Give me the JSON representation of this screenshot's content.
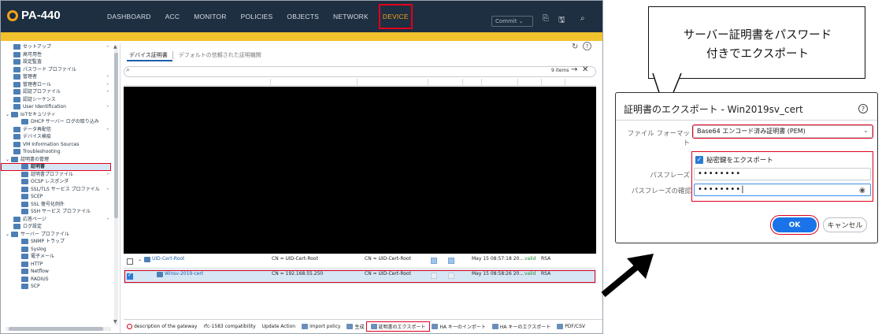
{
  "app": {
    "logo_text": "PA-440",
    "nav": [
      "DASHBOARD",
      "ACC",
      "MONITOR",
      "POLICIES",
      "OBJECTS",
      "NETWORK",
      "DEVICE"
    ],
    "active_nav": "DEVICE",
    "commit_label": "Commit",
    "accent_color": "#f3a21b",
    "highlight_color": "#e0001b"
  },
  "sidebar": {
    "items": [
      {
        "label": "セットアップ",
        "indent": 1,
        "icon": "setup-icon",
        "dot": true
      },
      {
        "label": "高可用性",
        "indent": 1,
        "icon": "ha-icon"
      },
      {
        "label": "設定監査",
        "indent": 1,
        "icon": "audit-icon"
      },
      {
        "label": "パスワード プロファイル",
        "indent": 1,
        "icon": "password-icon"
      },
      {
        "label": "管理者",
        "indent": 1,
        "icon": "admin-icon",
        "dot": true
      },
      {
        "label": "管理者ロール",
        "indent": 1,
        "icon": "role-icon",
        "dot": true
      },
      {
        "label": "認証プロファイル",
        "indent": 1,
        "icon": "auth-profile-icon",
        "dot": true
      },
      {
        "label": "認証シーケンス",
        "indent": 1,
        "icon": "auth-seq-icon"
      },
      {
        "label": "User Identification",
        "indent": 1,
        "icon": "user-id-icon",
        "dot": true
      },
      {
        "label": "IoTセキュリティ",
        "indent": 0,
        "icon": "iot-icon",
        "expander": true
      },
      {
        "label": "DHCP サーバー ログの取り込み",
        "indent": 2,
        "icon": "dhcp-icon"
      },
      {
        "label": "データ再配信",
        "indent": 1,
        "icon": "redistribution-icon",
        "dot": true
      },
      {
        "label": "デバイス検疫",
        "indent": 1,
        "icon": "quarantine-icon"
      },
      {
        "label": "VM Information Sources",
        "indent": 1,
        "icon": "vm-icon"
      },
      {
        "label": "Troubleshooting",
        "indent": 1,
        "icon": "troubleshoot-icon"
      },
      {
        "label": "証明書の管理",
        "indent": 0,
        "icon": "cert-mgmt-icon",
        "expander": true
      },
      {
        "label": "証明書",
        "indent": 2,
        "icon": "cert-icon",
        "active": true
      },
      {
        "label": "証明書プロファイル",
        "indent": 2,
        "icon": "cert-profile-icon",
        "dot": true
      },
      {
        "label": "OCSP レスポンダ",
        "indent": 2,
        "icon": "ocsp-icon"
      },
      {
        "label": "SSL/TLS サービス プロファイル",
        "indent": 2,
        "icon": "ssl-profile-icon",
        "dot": true
      },
      {
        "label": "SCEP",
        "indent": 2,
        "icon": "scep-icon"
      },
      {
        "label": "SSL 復号化例外",
        "indent": 2,
        "icon": "ssl-exclusion-icon"
      },
      {
        "label": "SSH サービス プロファイル",
        "indent": 2,
        "icon": "ssh-profile-icon"
      },
      {
        "label": "応答ページ",
        "indent": 1,
        "icon": "response-page-icon",
        "dot": true
      },
      {
        "label": "ログ設定",
        "indent": 1,
        "icon": "log-settings-icon"
      },
      {
        "label": "サーバー プロファイル",
        "indent": 0,
        "icon": "server-profile-icon",
        "expander": true
      },
      {
        "label": "SNMP トラップ",
        "indent": 2,
        "icon": "snmp-icon"
      },
      {
        "label": "Syslog",
        "indent": 2,
        "icon": "syslog-icon"
      },
      {
        "label": "電子メール",
        "indent": 2,
        "icon": "email-icon"
      },
      {
        "label": "HTTP",
        "indent": 2,
        "icon": "http-icon"
      },
      {
        "label": "Netflow",
        "indent": 2,
        "icon": "netflow-icon"
      },
      {
        "label": "RADIUS",
        "indent": 2,
        "icon": "radius-icon"
      },
      {
        "label": "SCP",
        "indent": 2,
        "icon": "scp-icon"
      }
    ]
  },
  "content": {
    "tabs": [
      {
        "label": "デバイス証明書",
        "active": true
      },
      {
        "label": "デフォルトの信頼された証明機関",
        "active": false
      }
    ],
    "search_value": "",
    "items_count": "9 items",
    "rows": [
      {
        "name": "UID-Cert-Root",
        "subject": "CN = UID-Cert-Root",
        "issuer": "CN = UID-Cert-Root",
        "ca": true,
        "key": true,
        "expires": "May 15 08:57:18 20...",
        "status": "valid",
        "algorithm": "RSA",
        "selected": false,
        "expander": true
      },
      {
        "name": "Winsv-2019-cert",
        "subject": "CN = 192.168.55.250",
        "issuer": "CN = UID-Cert-Root",
        "ca": false,
        "key": false,
        "expires": "May 15 08:58:26 20...",
        "status": "valid",
        "algorithm": "RSA",
        "selected": true,
        "expander": false
      }
    ]
  },
  "bottombar": {
    "items": [
      {
        "label": "description of the gateway",
        "icon": "delete-icon"
      },
      {
        "label": "rfc-1583 compatibility",
        "icon": ""
      },
      {
        "label": "Update Action",
        "icon": ""
      },
      {
        "label": "import policy",
        "icon": "import-icon"
      },
      {
        "label": "生成",
        "icon": "generate-icon"
      },
      {
        "label": "証明書のエクスポート",
        "icon": "export-cert-icon",
        "highlight": true
      },
      {
        "label": "HA キーのインポート",
        "icon": "ha-import-icon"
      },
      {
        "label": "HA キーのエクスポート",
        "icon": "ha-export-icon"
      },
      {
        "label": "PDF/CSV",
        "icon": "pdf-csv-icon"
      }
    ]
  },
  "callout": {
    "line1": "サーバー証明書をパスワード",
    "line2": "付きでエクスポート"
  },
  "dialog": {
    "title": "証明書のエクスポート - Win2019sv_cert",
    "format_label": "ファイル フォーマット",
    "format_value": "Base64 エンコード済み証明書 (PEM)",
    "export_key_label": "秘密鍵をエクスポート",
    "export_key_checked": true,
    "passphrase_label": "パスフレーズ",
    "passphrase_value": "••••••••",
    "confirm_label": "パスフレーズの確認",
    "confirm_value": "••••••••",
    "ok_label": "OK",
    "cancel_label": "キャンセル"
  }
}
